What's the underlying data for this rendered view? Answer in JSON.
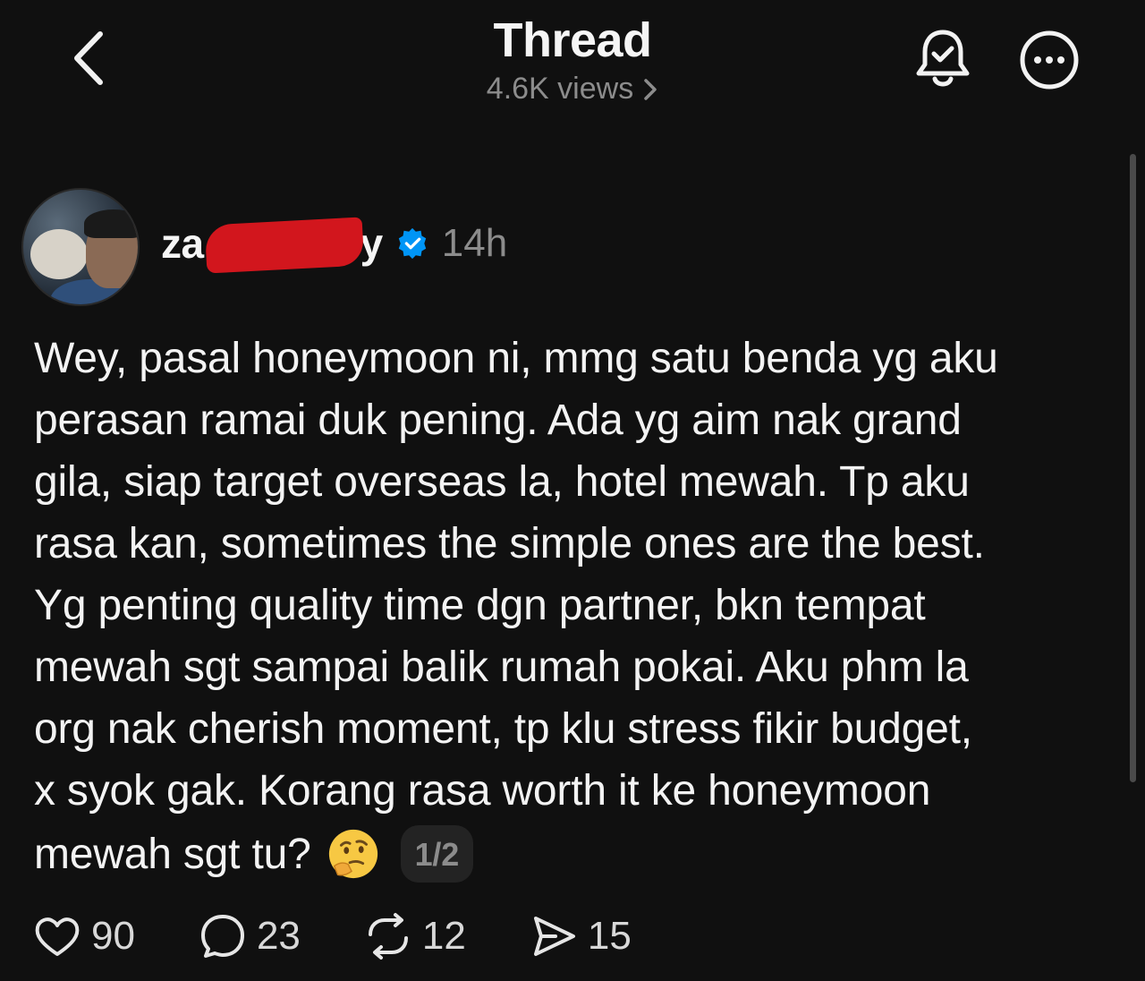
{
  "header": {
    "title": "Thread",
    "views_text": "4.6K views",
    "back_icon": "chevron-left-icon",
    "bell_icon": "bell-check-icon",
    "more_icon": "more-horizontal-circle-icon"
  },
  "post": {
    "username_visible_prefix": "za",
    "username_visible_suffix": "ey",
    "verified": true,
    "time": "14h",
    "text_lines": [
      "Wey, pasal honeymoon ni, mmg satu benda yg aku",
      "perasan ramai duk pening. Ada yg aim nak grand",
      "gila, siap target overseas la, hotel mewah. Tp aku",
      "rasa kan, sometimes the simple ones are the best.",
      "Yg penting quality time dgn partner, bkn tempat",
      "mewah sgt sampai balik rumah pokai. Aku phm la",
      "org nak cherish moment, tp klu stress fikir budget,",
      "x syok gak. Korang rasa worth it ke honeymoon"
    ],
    "last_line": "mewah sgt tu?",
    "emoji": "thinking-face-emoji",
    "page_indicator": "1/2"
  },
  "actions": {
    "likes": "90",
    "replies": "23",
    "reposts": "12",
    "shares": "15"
  },
  "colors": {
    "background": "#101010",
    "text": "#f3f3f3",
    "muted": "#8c8c8c",
    "verified": "#0095f6",
    "redaction": "#d2161d"
  }
}
